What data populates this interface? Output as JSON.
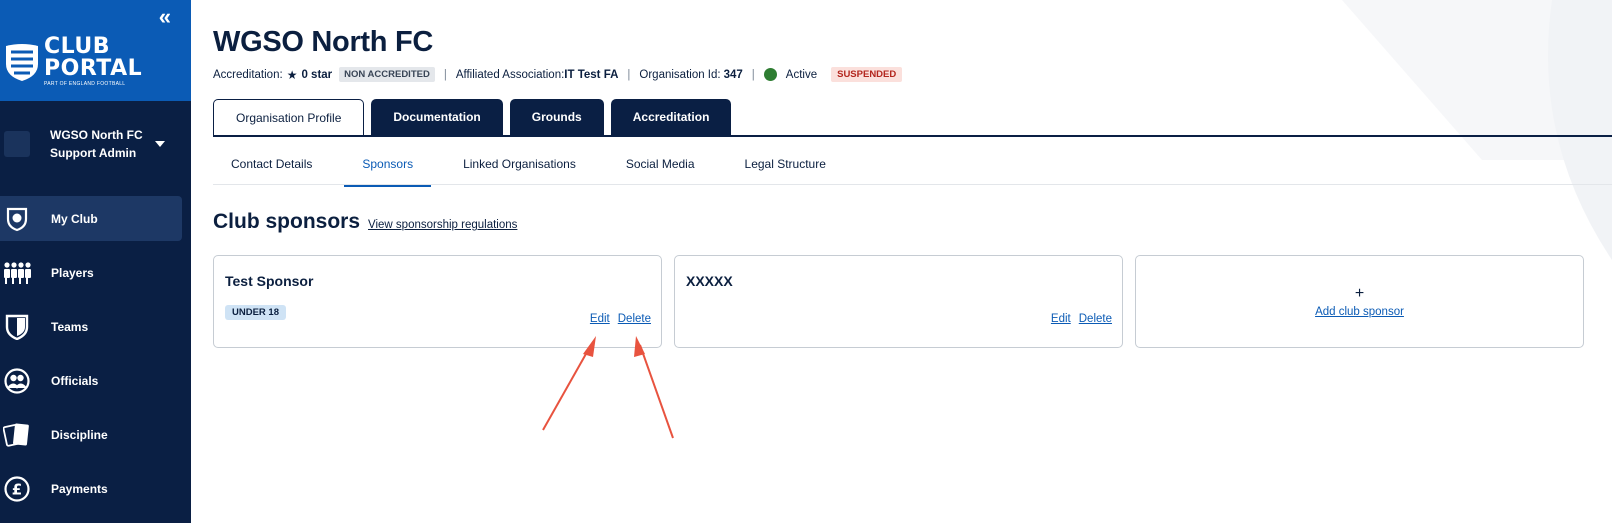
{
  "sidebar": {
    "collapse_glyph": "«",
    "logo": {
      "line1": "CLUB",
      "line2": "PORTAL",
      "tagline": "PART OF ENGLAND FOOTBALL"
    },
    "club_selector": {
      "club_name": "WGSO North FC",
      "role": "Support Admin"
    },
    "nav": [
      {
        "label": "My Club",
        "icon": "club-crest-icon",
        "active": true
      },
      {
        "label": "Players",
        "icon": "players-icon",
        "active": false
      },
      {
        "label": "Teams",
        "icon": "shield-icon",
        "active": false
      },
      {
        "label": "Officials",
        "icon": "officials-icon",
        "active": false
      },
      {
        "label": "Discipline",
        "icon": "cards-icon",
        "active": false
      },
      {
        "label": "Payments",
        "icon": "pound-icon",
        "active": false
      }
    ]
  },
  "header": {
    "title": "WGSO North FC",
    "meta": {
      "accreditation_label": "Accreditation:",
      "accreditation_value": "0 star",
      "accreditation_badge": "NON ACCREDITED",
      "association_label": "Affiliated Association:",
      "association_value": "IT Test FA",
      "org_id_label": "Organisation Id:",
      "org_id_value": "347",
      "status": "Active",
      "status_badge": "SUSPENDED"
    }
  },
  "tabs": [
    "Organisation Profile",
    "Documentation",
    "Grounds",
    "Accreditation"
  ],
  "subtabs": [
    "Contact Details",
    "Sponsors",
    "Linked Organisations",
    "Social Media",
    "Legal Structure"
  ],
  "active_subtab": "Sponsors",
  "section": {
    "title": "Club sponsors",
    "link": "View sponsorship regulations"
  },
  "sponsors": [
    {
      "name": "Test Sponsor",
      "tag": "UNDER 18",
      "edit": "Edit",
      "delete": "Delete"
    },
    {
      "name": "XXXXX",
      "edit": "Edit",
      "delete": "Delete"
    }
  ],
  "add_card": {
    "plus": "+",
    "label": "Add club sponsor"
  },
  "colors": {
    "sidebar": "#0a1f44",
    "brand_blue": "#0b5bb5",
    "status_green": "#2e7d32",
    "suspended_red": "#b3261e",
    "annotation_arrow": "#e8533f"
  }
}
